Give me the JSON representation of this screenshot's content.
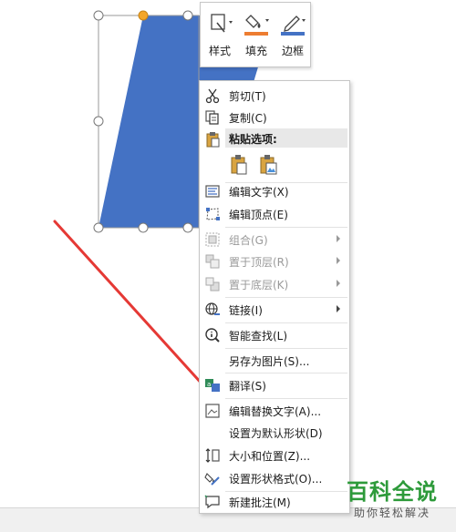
{
  "mini_toolbar": {
    "style_label": "样式",
    "fill_label": "填充",
    "border_label": "边框",
    "fill_color": "#ed7d31",
    "border_color": "#4472c4"
  },
  "shape": {
    "fill_color": "#4472c4"
  },
  "context_menu": {
    "cut": "剪切(T)",
    "copy": "复制(C)",
    "paste_options": "粘贴选项:",
    "edit_text": "编辑文字(X)",
    "edit_points": "编辑顶点(E)",
    "group": "组合(G)",
    "bring_to_front": "置于顶层(R)",
    "send_to_back": "置于底层(K)",
    "link": "链接(I)",
    "smart_lookup": "智能查找(L)",
    "save_as_picture": "另存为图片(S)...",
    "translate": "翻译(S)",
    "edit_alt_text": "编辑替换文字(A)...",
    "set_default_shape": "设置为默认形状(D)",
    "size_and_position": "大小和位置(Z)...",
    "format_shape": "设置形状格式(O)...",
    "new_comment": "新建批注(M)"
  },
  "watermark": {
    "title": "百科全说",
    "subtitle": "助你轻松解决"
  },
  "annotation_color": "#e53935"
}
